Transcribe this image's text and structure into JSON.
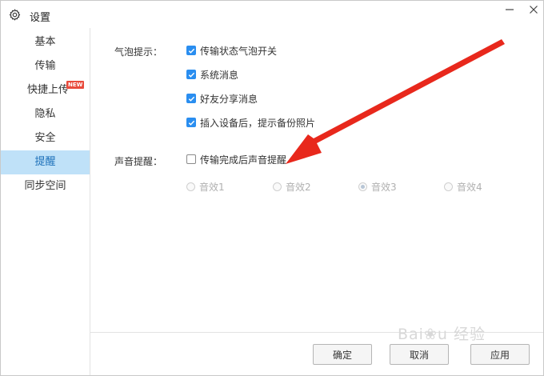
{
  "window": {
    "title": "设置",
    "icon": "gear-icon"
  },
  "sidebar": {
    "items": [
      {
        "label": "基本",
        "active": false
      },
      {
        "label": "传输",
        "active": false
      },
      {
        "label": "快捷上传",
        "active": false,
        "badge": "NEW"
      },
      {
        "label": "隐私",
        "active": false
      },
      {
        "label": "安全",
        "active": false
      },
      {
        "label": "提醒",
        "active": true
      },
      {
        "label": "同步空间",
        "active": false
      }
    ]
  },
  "bubble": {
    "label": "气泡提示：",
    "options": [
      {
        "label": "传输状态气泡开关",
        "checked": true
      },
      {
        "label": "系统消息",
        "checked": true
      },
      {
        "label": "好友分享消息",
        "checked": true
      },
      {
        "label": "插入设备后，提示备份照片",
        "checked": true
      }
    ]
  },
  "sound": {
    "label": "声音提醒：",
    "option": {
      "label": "传输完成后声音提醒",
      "checked": false
    },
    "effects": [
      {
        "label": "音效1",
        "selected": false
      },
      {
        "label": "音效2",
        "selected": false
      },
      {
        "label": "音效3",
        "selected": true
      },
      {
        "label": "音效4",
        "selected": false
      }
    ]
  },
  "footer": {
    "ok": "确定",
    "cancel": "取消",
    "apply": "应用"
  },
  "colors": {
    "accent": "#2a8ef0",
    "active_bg": "#bfe1f8",
    "badge": "#e94b3c",
    "arrow": "#e8281c"
  }
}
